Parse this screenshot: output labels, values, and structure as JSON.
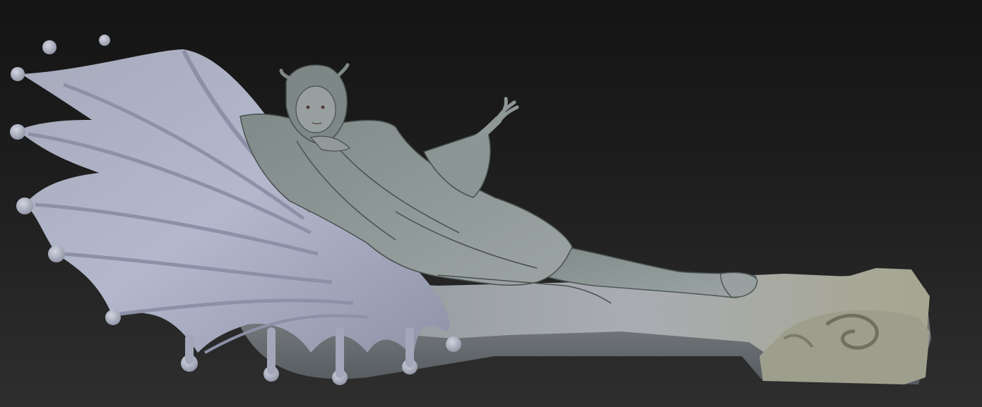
{
  "scene": {
    "subject": "sculpt-render",
    "background_top": "#141414",
    "background_bottom": "#2e2e2e",
    "colors": {
      "clay": "#8a9593",
      "clay_dark": "#4f5857",
      "wing": "#a7acc2",
      "wing_shade": "#7b7f96",
      "base": "#9fa3a7",
      "base_warm": "#a7a68f"
    }
  }
}
